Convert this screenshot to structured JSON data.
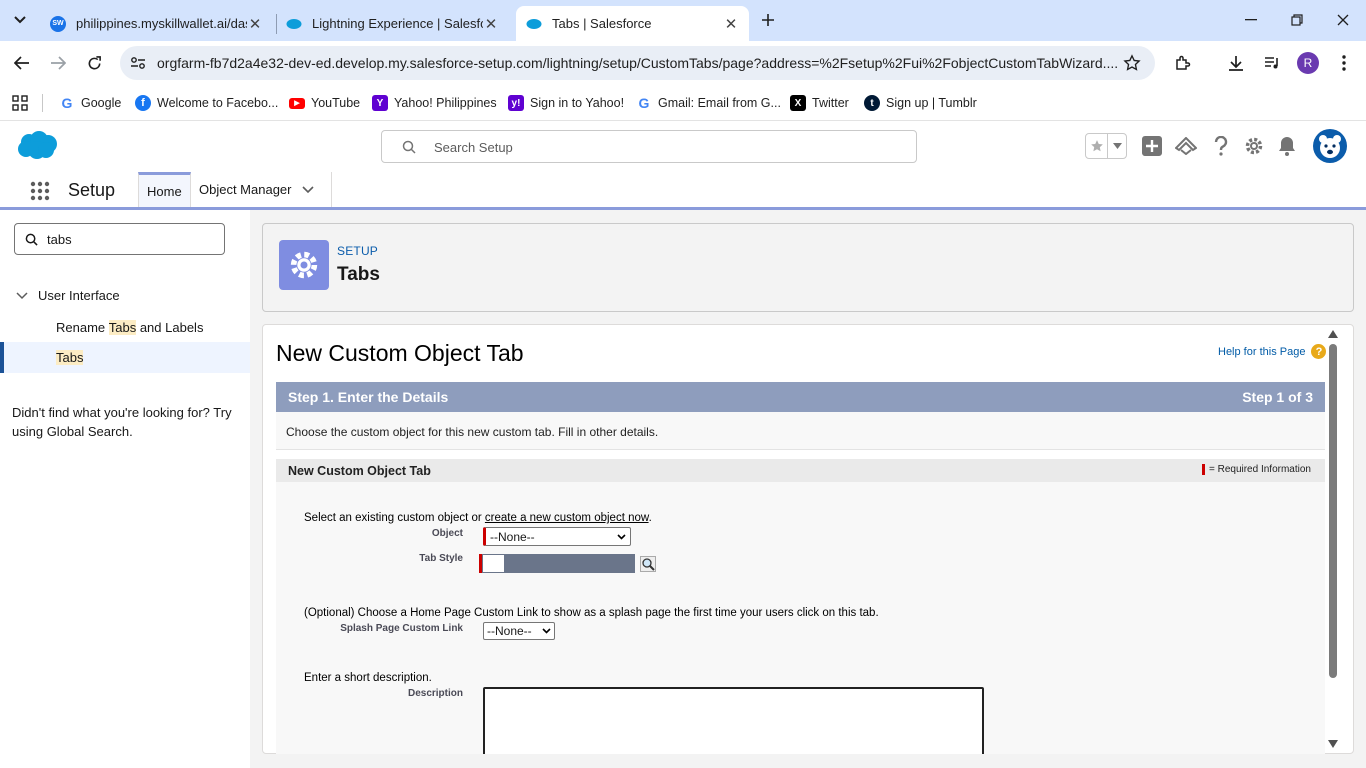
{
  "browser": {
    "tabs": [
      {
        "title": "philippines.myskillwallet.ai/dash",
        "active": false
      },
      {
        "title": "Lightning Experience | Salesforce",
        "active": false
      },
      {
        "title": "Tabs | Salesforce",
        "active": true
      }
    ],
    "url": "orgfarm-fb7d2a4e32-dev-ed.develop.my.salesforce-setup.com/lightning/setup/CustomTabs/page?address=%2Fsetup%2Fui%2FobjectCustomTabWizard....",
    "profile_initial": "R",
    "bookmarks": [
      {
        "label": "Google",
        "icon": "google-icon"
      },
      {
        "label": "Welcome to Facebo...",
        "icon": "facebook-icon"
      },
      {
        "label": "YouTube",
        "icon": "youtube-icon"
      },
      {
        "label": "Yahoo! Philippines",
        "icon": "yahoo-icon"
      },
      {
        "label": "Sign in to Yahoo!",
        "icon": "yahoo-icon"
      },
      {
        "label": "Gmail: Email from G...",
        "icon": "google-icon"
      },
      {
        "label": "Twitter",
        "icon": "x-icon"
      },
      {
        "label": "Sign up | Tumblr",
        "icon": "tumblr-icon"
      }
    ]
  },
  "sf": {
    "search_placeholder": "Search Setup",
    "app_name": "Setup",
    "nav": {
      "home": "Home",
      "object_manager": "Object Manager"
    },
    "brand_color": "#0b5cab"
  },
  "sidebar": {
    "quick_find_value": "tabs",
    "group_label": "User Interface",
    "items": [
      {
        "pre": "Rename ",
        "hl": "Tabs",
        "post": " and Labels"
      },
      {
        "pre": "",
        "hl": "Tabs",
        "post": ""
      }
    ],
    "not_found": "Didn't find what you're looking for? Try using Global Search."
  },
  "page_header": {
    "eyebrow": "SETUP",
    "title": "Tabs"
  },
  "wizard": {
    "title": "New Custom Object Tab",
    "help_link": "Help for this Page",
    "step_title": "Step 1. Enter the Details",
    "step_count": "Step 1 of 3",
    "step_desc": "Choose the custom object for this new custom tab. Fill in other details.",
    "section_title": "New Custom Object Tab",
    "required_info": "= Required Information",
    "select_text_pre": "Select an existing custom object or ",
    "select_link": "create a new custom object now",
    "select_text_post": ".",
    "object_label": "Object",
    "object_value": "--None--",
    "tab_style_label": "Tab Style",
    "splash_text": "(Optional) Choose a Home Page Custom Link to show as a splash page the first time your users click on this tab.",
    "splash_label": "Splash Page Custom Link",
    "splash_value": "--None--",
    "desc_text": "Enter a short description.",
    "desc_label": "Description",
    "desc_value": ""
  }
}
